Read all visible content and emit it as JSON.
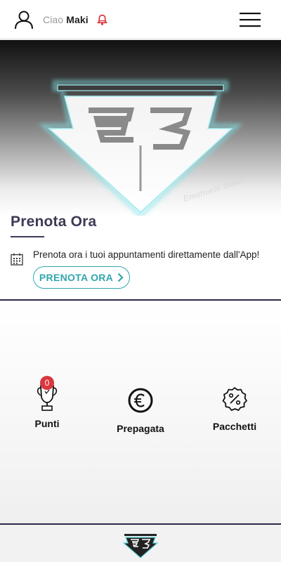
{
  "header": {
    "greeting": "Ciao",
    "user_name": "Maki",
    "icons": {
      "user": "user-icon",
      "bell": "bell-icon",
      "menu": "hamburger-menu-icon"
    },
    "accent_color": "#d9363e"
  },
  "hero": {
    "logo": "eb-logo",
    "signature": "Emanuele Bossi"
  },
  "booking": {
    "title": "Prenota Ora",
    "description": "Prenota ora i tuoi appuntamenti direttamente dall'App!",
    "button_label": "PRENOTA ORA",
    "icons": {
      "calendar": "calendar-icon",
      "chevron": "chevron-right-icon"
    },
    "button_color": "#2fa6ad"
  },
  "features": [
    {
      "label": "Punti",
      "icon": "trophy-icon",
      "badge": "0"
    },
    {
      "label": "Prepagata",
      "icon": "euro-coin-icon"
    },
    {
      "label": "Pacchetti",
      "icon": "discount-badge-icon"
    }
  ],
  "footer": {
    "logo": "eb-logo-small"
  }
}
